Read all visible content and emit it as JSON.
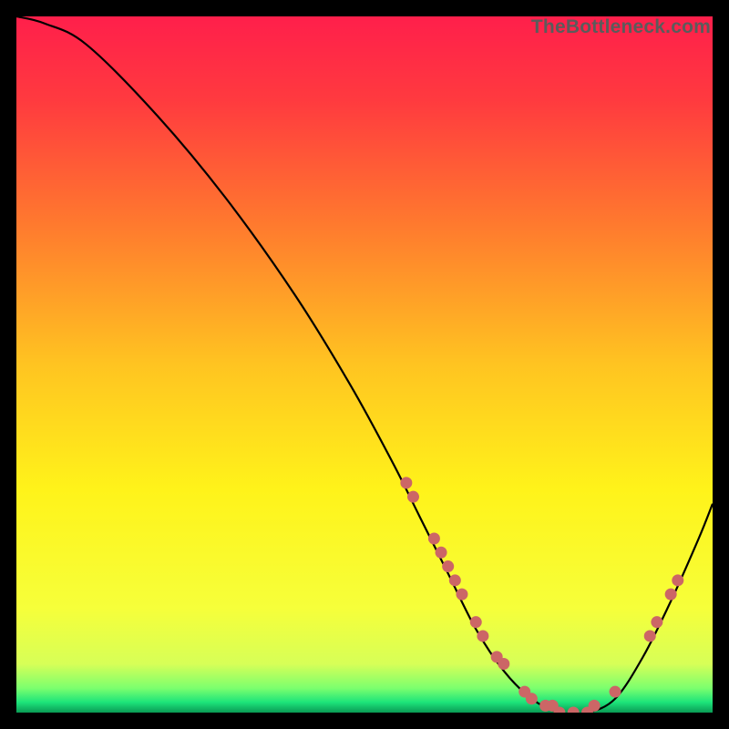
{
  "watermark": "TheBottleneck.com",
  "chart_data": {
    "type": "line",
    "title": "",
    "xlabel": "",
    "ylabel": "",
    "xlim": [
      0,
      100
    ],
    "ylim": [
      0,
      100
    ],
    "gradient_stops": [
      {
        "offset": 0.0,
        "color": "#ff1f4b"
      },
      {
        "offset": 0.12,
        "color": "#ff3a3f"
      },
      {
        "offset": 0.3,
        "color": "#ff7a2e"
      },
      {
        "offset": 0.5,
        "color": "#ffc421"
      },
      {
        "offset": 0.68,
        "color": "#fff31a"
      },
      {
        "offset": 0.85,
        "color": "#f6ff3a"
      },
      {
        "offset": 0.93,
        "color": "#d7ff57"
      },
      {
        "offset": 0.965,
        "color": "#7bff6e"
      },
      {
        "offset": 0.985,
        "color": "#1de47a"
      },
      {
        "offset": 1.0,
        "color": "#0a9b55"
      }
    ],
    "series": [
      {
        "name": "bottleneck-curve",
        "color": "#000000",
        "x": [
          0,
          4,
          10,
          20,
          30,
          40,
          48,
          54,
          58,
          62,
          66,
          70,
          74,
          78,
          82,
          86,
          90,
          94,
          98,
          100
        ],
        "y": [
          100,
          99,
          96,
          86,
          74,
          60,
          47,
          36,
          28,
          20,
          12,
          6,
          2,
          0,
          0,
          2,
          8,
          16,
          25,
          30
        ]
      }
    ],
    "markers": {
      "color": "#cc6666",
      "radius": 6.5,
      "points": [
        {
          "x": 56,
          "y": 33
        },
        {
          "x": 57,
          "y": 31
        },
        {
          "x": 60,
          "y": 25
        },
        {
          "x": 61,
          "y": 23
        },
        {
          "x": 62,
          "y": 21
        },
        {
          "x": 63,
          "y": 19
        },
        {
          "x": 64,
          "y": 17
        },
        {
          "x": 66,
          "y": 13
        },
        {
          "x": 67,
          "y": 11
        },
        {
          "x": 69,
          "y": 8
        },
        {
          "x": 70,
          "y": 7
        },
        {
          "x": 73,
          "y": 3
        },
        {
          "x": 74,
          "y": 2
        },
        {
          "x": 76,
          "y": 1
        },
        {
          "x": 77,
          "y": 1
        },
        {
          "x": 78,
          "y": 0
        },
        {
          "x": 80,
          "y": 0
        },
        {
          "x": 82,
          "y": 0
        },
        {
          "x": 83,
          "y": 1
        },
        {
          "x": 86,
          "y": 3
        },
        {
          "x": 91,
          "y": 11
        },
        {
          "x": 92,
          "y": 13
        },
        {
          "x": 94,
          "y": 17
        },
        {
          "x": 95,
          "y": 19
        }
      ]
    }
  }
}
